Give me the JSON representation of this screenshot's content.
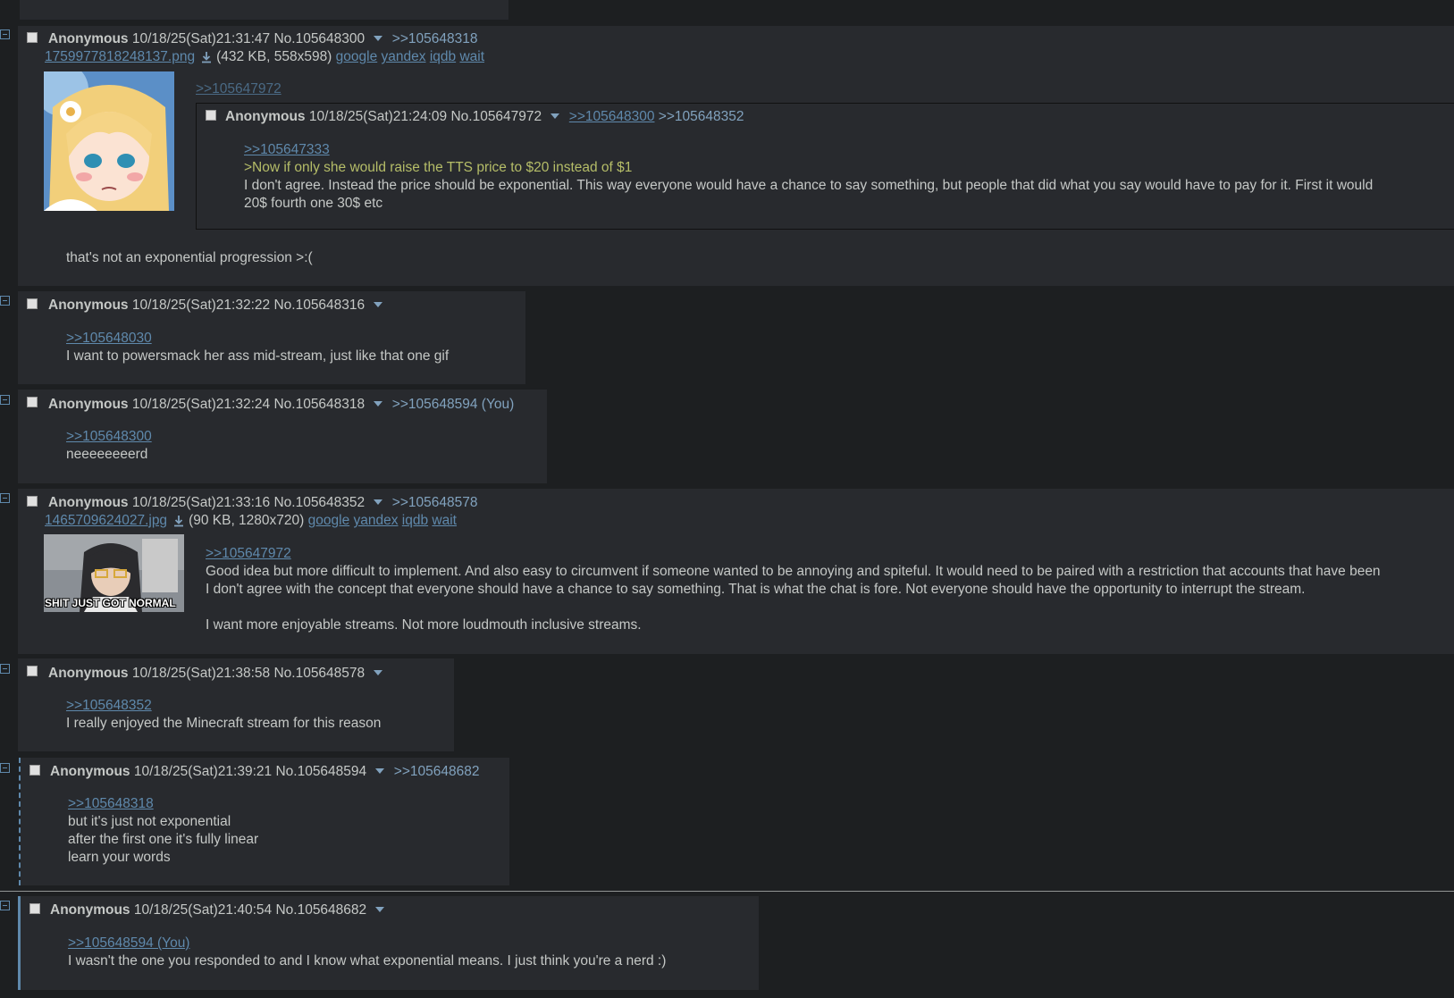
{
  "posts": [
    {
      "name": "Anonymous",
      "datetime": "10/18/25(Sat)21:31:47",
      "no": "No.105648300",
      "backlinks": ">>105648318",
      "file": {
        "name": "1759977818248137.png",
        "meta": "(432 KB, 558x598)",
        "google": "google",
        "yandex": "yandex",
        "iqdb": "iqdb",
        "wait": "wait"
      },
      "quote_ref": ">>105647972",
      "inline": {
        "name": "Anonymous",
        "datetime": "10/18/25(Sat)21:24:09",
        "no": "No.105647972",
        "backlink1": ">>105648300",
        "backlink2": ">>105648352",
        "quote": ">>105647333",
        "greentext": ">Now if only she would raise the TTS price to $20 instead of $1",
        "line1": "I don't agree. Instead the price should be exponential. This way everyone would have a chance to say something, but people that did what you say would have to pay for it. First it would",
        "line2": "20$ fourth one 30$ etc"
      },
      "comment": "that's not an exponential progression >:("
    },
    {
      "name": "Anonymous",
      "datetime": "10/18/25(Sat)21:32:22",
      "no": "No.105648316",
      "quote": ">>105648030",
      "comment": "I want to powersmack her ass mid-stream, just like that one gif"
    },
    {
      "name": "Anonymous",
      "datetime": "10/18/25(Sat)21:32:24",
      "no": "No.105648318",
      "backlinks": ">>105648594 (You)",
      "quote": ">>105648300",
      "comment": "neeeeeeeerd"
    },
    {
      "name": "Anonymous",
      "datetime": "10/18/25(Sat)21:33:16",
      "no": "No.105648352",
      "backlinks": ">>105648578",
      "file": {
        "name": "1465709624027.jpg",
        "meta": "(90 KB, 1280x720)",
        "google": "google",
        "yandex": "yandex",
        "iqdb": "iqdb",
        "wait": "wait"
      },
      "thumb_caption": "SHIT JUST GOT NORMAL",
      "quote": ">>105647972",
      "line1": "Good idea but more difficult to implement. And also easy to circumvent if someone wanted to be annoying and spiteful. It would need to be paired with a restriction that accounts that have been",
      "line2": "I don't agree with the concept that everyone should have a chance to say something. That is what the chat is fore. Not everyone should have the opportunity to interrupt the stream.",
      "line3": "I want more enjoyable streams. Not more loudmouth inclusive streams."
    },
    {
      "name": "Anonymous",
      "datetime": "10/18/25(Sat)21:38:58",
      "no": "No.105648578",
      "quote": ">>105648352",
      "comment": "I really enjoyed the Minecraft stream for this reason"
    },
    {
      "name": "Anonymous",
      "datetime": "10/18/25(Sat)21:39:21",
      "no": "No.105648594",
      "backlinks": ">>105648682",
      "quote": ">>105648318",
      "line1": "but it's just not exponential",
      "line2": "after the first one it's fully linear",
      "line3": "learn your words"
    },
    {
      "name": "Anonymous",
      "datetime": "10/18/25(Sat)21:40:54",
      "no": "No.105648682",
      "quote": ">>105648594 (You)",
      "comment": "I wasn't the one you responded to and I know what exponential means. I just think you're a nerd :)"
    }
  ],
  "colors": {
    "bg": "#1d1f21",
    "post": "#282a2e",
    "link": "#5f89ac",
    "greentext": "#b5bd68",
    "text": "#c5c8c6"
  },
  "icons": [
    "toggle-icon",
    "checkbox",
    "caret-down-icon",
    "download-icon"
  ]
}
